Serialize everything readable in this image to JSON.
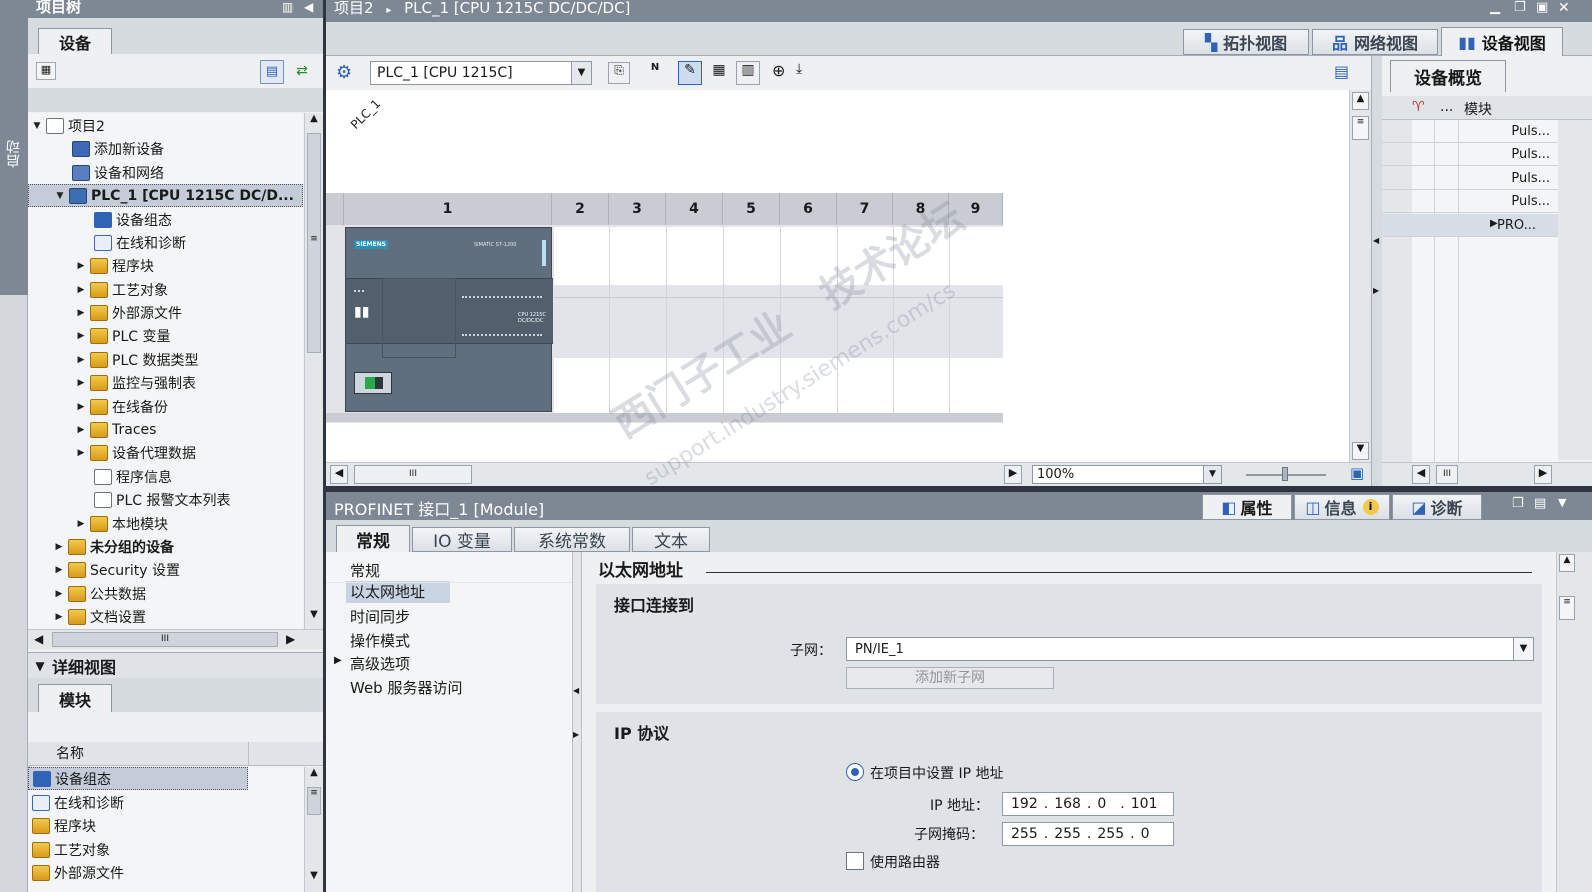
{
  "left_strip": {
    "label": "启动"
  },
  "project_tree": {
    "title": "项目树",
    "tab": "设备",
    "items": [
      {
        "label": "项目2",
        "bold": false
      },
      {
        "label": "添加新设备"
      },
      {
        "label": "设备和网络"
      },
      {
        "label": "PLC_1 [CPU 1215C DC/D..."
      },
      {
        "label": "设备组态"
      },
      {
        "label": "在线和诊断"
      },
      {
        "label": "程序块"
      },
      {
        "label": "工艺对象"
      },
      {
        "label": "外部源文件"
      },
      {
        "label": "PLC 变量"
      },
      {
        "label": "PLC 数据类型"
      },
      {
        "label": "监控与强制表"
      },
      {
        "label": "在线备份"
      },
      {
        "label": "Traces"
      },
      {
        "label": "设备代理数据"
      },
      {
        "label": "程序信息"
      },
      {
        "label": "PLC 报警文本列表"
      },
      {
        "label": "本地模块"
      },
      {
        "label": "未分组的设备"
      },
      {
        "label": "Security 设置"
      },
      {
        "label": "公共数据"
      },
      {
        "label": "文档设置"
      }
    ],
    "hscroll_grip": "III"
  },
  "detail_view": {
    "title": "详细视图",
    "tab": "模块",
    "col_name": "名称",
    "rows": [
      "设备组态",
      "在线和诊断",
      "程序块",
      "工艺对象",
      "外部源文件"
    ]
  },
  "editor": {
    "breadcrumb_project": "项目2",
    "breadcrumb_sep": "▸",
    "breadcrumb_device": "PLC_1 [CPU 1215C DC/DC/DC]",
    "view_tabs": {
      "topology": "拓扑视图",
      "network": "网络视图",
      "device": "设备视图"
    },
    "device_select": "PLC_1 [CPU 1215C]",
    "plc_label": "PLC_1",
    "slots": [
      "1",
      "2",
      "3",
      "4",
      "5",
      "6",
      "7",
      "8",
      "9"
    ],
    "cpu_brand": "SIEMENS",
    "cpu_model_text": "SIMATIC S7-1200",
    "cpu_type_text": "CPU 1215C DC/DC/DC",
    "zoom": "100%",
    "hscroll_grip": "III"
  },
  "overview": {
    "title": "设备概览",
    "col_dots": "...",
    "col_module": "模块",
    "rows": [
      "Puls...",
      "Puls...",
      "Puls...",
      "Puls...",
      "PRO..."
    ]
  },
  "properties": {
    "title": "PROFINET 接口_1 [Module]",
    "tabs_right": {
      "props": "属性",
      "info": "信息",
      "diag": "诊断"
    },
    "tabs": [
      "常规",
      "IO 变量",
      "系统常数",
      "文本"
    ],
    "nav": [
      "常规",
      "以太网地址",
      "时间同步",
      "操作模式",
      "高级选项",
      "Web 服务器访问"
    ],
    "section_title": "以太网地址",
    "interface_group": "接口连接到",
    "subnet_label": "子网：",
    "subnet_value": "PN/IE_1",
    "add_subnet_btn": "添加新子网",
    "ip_group": "IP 协议",
    "radio_set_ip": "在项目中设置 IP 地址",
    "ip_label": "IP 地址：",
    "ip_parts": [
      "192",
      "168",
      "0",
      "101"
    ],
    "mask_label": "子网掩码：",
    "mask_parts": [
      "255",
      "255",
      "255",
      "0"
    ],
    "use_router": "使用路由器"
  },
  "watermark": {
    "line1": "西门子工业",
    "line2": "技术论坛",
    "url": "support.industry.siemens.com/cs"
  },
  "colors": {
    "frame": "#2e3540",
    "cpu": "#5f6f7d",
    "selected": "#c9d4e2",
    "accent_blue": "#2f63b8"
  }
}
